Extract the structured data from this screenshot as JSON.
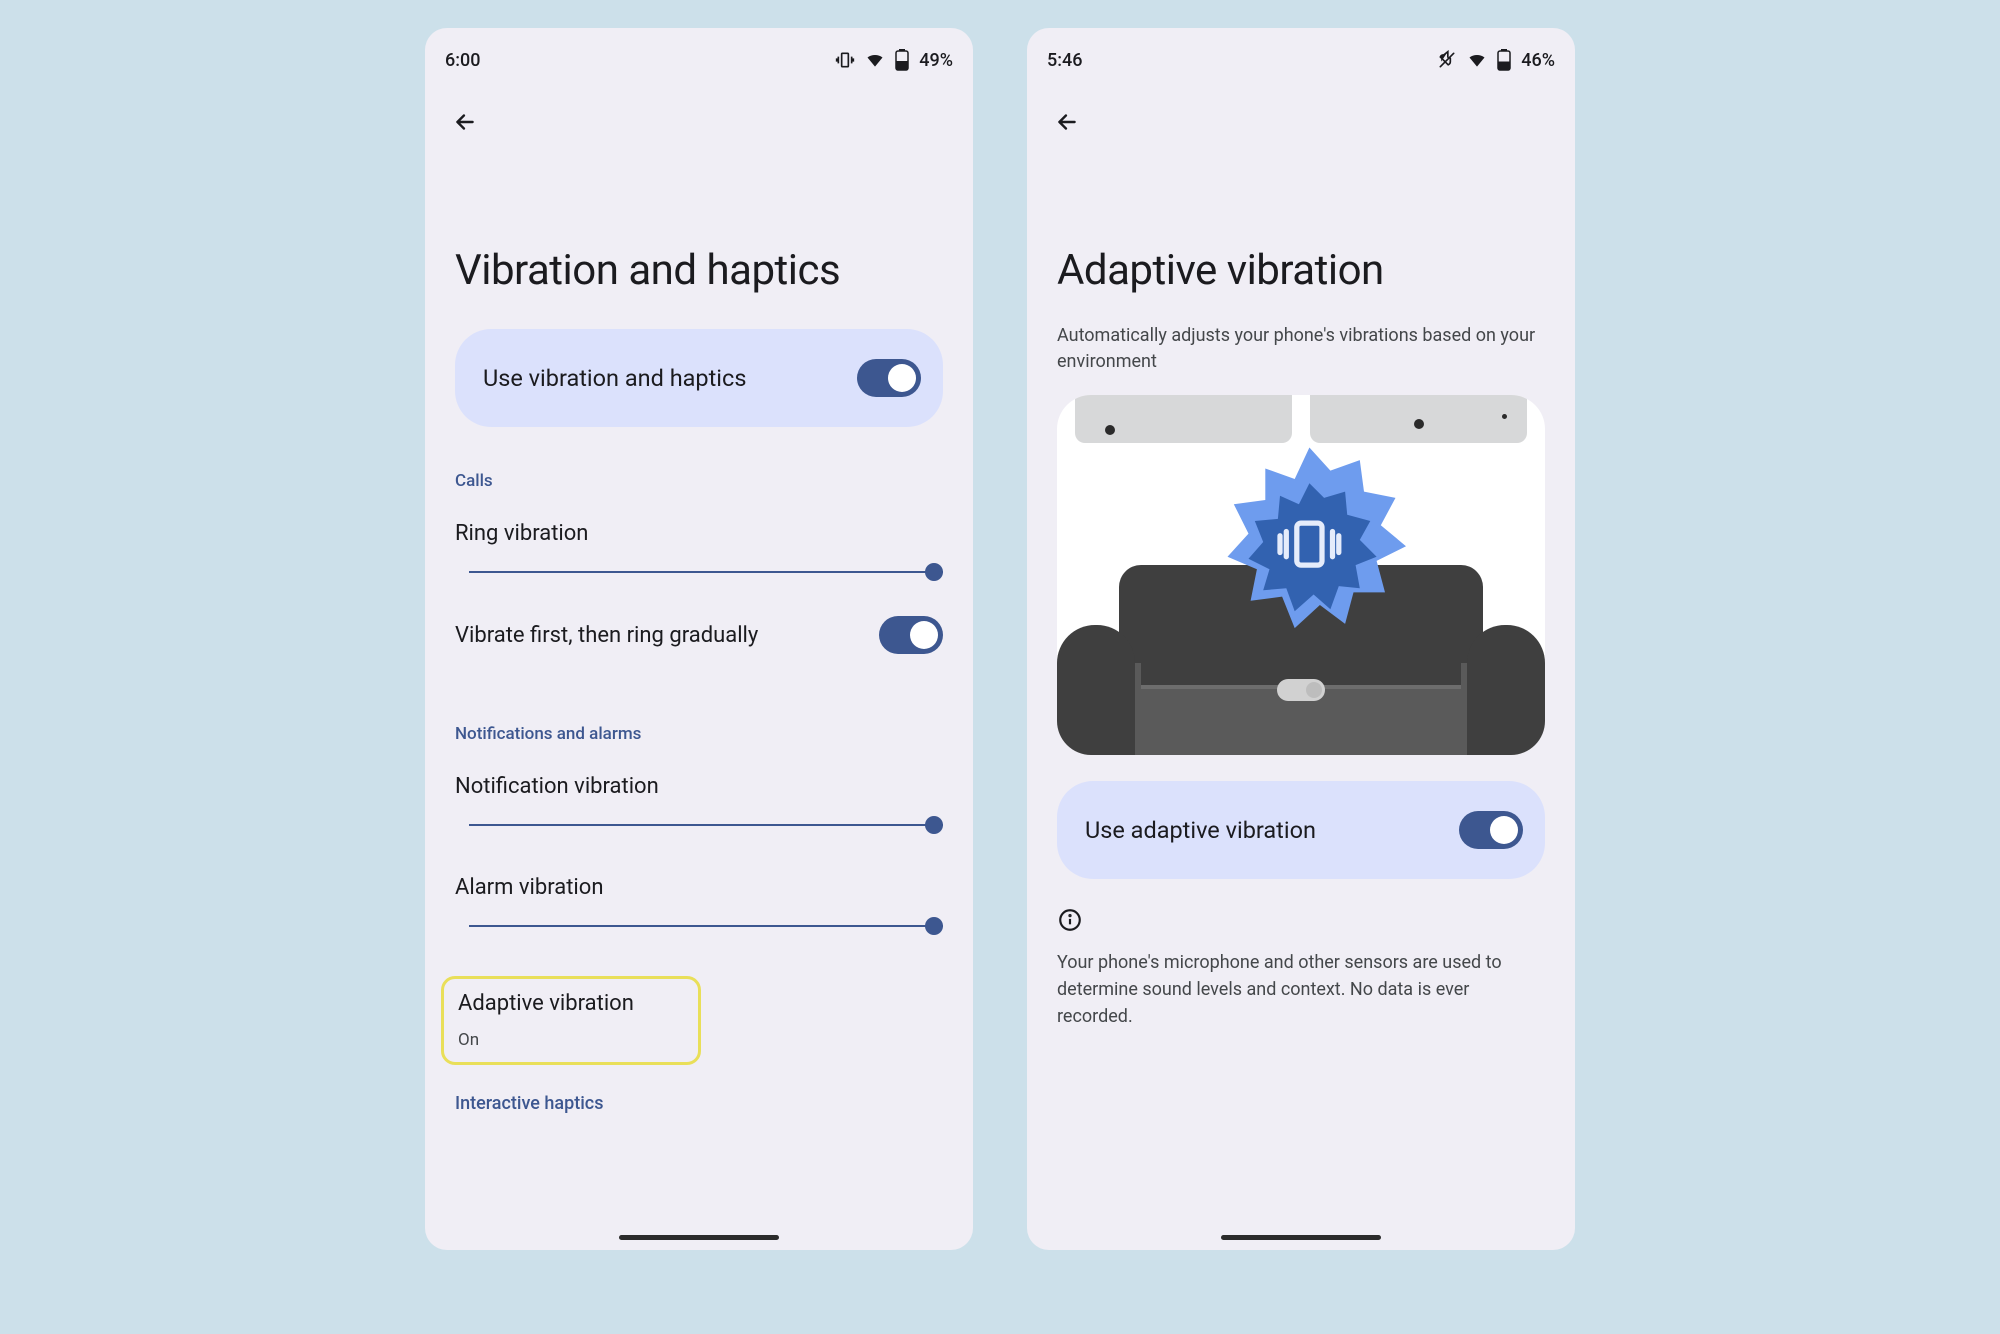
{
  "phone1": {
    "status": {
      "time": "6:00",
      "battery": "49%"
    },
    "title": "Vibration and haptics",
    "primaryToggle": "Use vibration and haptics",
    "sections": {
      "calls": {
        "label": "Calls",
        "ring": "Ring vibration",
        "vibrateFirst": "Vibrate first, then ring gradually"
      },
      "notif": {
        "label": "Notifications and alarms",
        "notification": "Notification vibration",
        "alarm": "Alarm vibration"
      },
      "adaptive": {
        "title": "Adaptive vibration",
        "status": "On"
      },
      "interactive": "Interactive haptics"
    }
  },
  "phone2": {
    "status": {
      "time": "5:46",
      "battery": "46%"
    },
    "title": "Adaptive vibration",
    "subtitle": "Automatically adjusts your phone's vibrations based on your environment",
    "toggle": "Use adaptive vibration",
    "info": "Your phone's microphone and other sensors are used to determine sound levels and context. No data is ever recorded."
  }
}
